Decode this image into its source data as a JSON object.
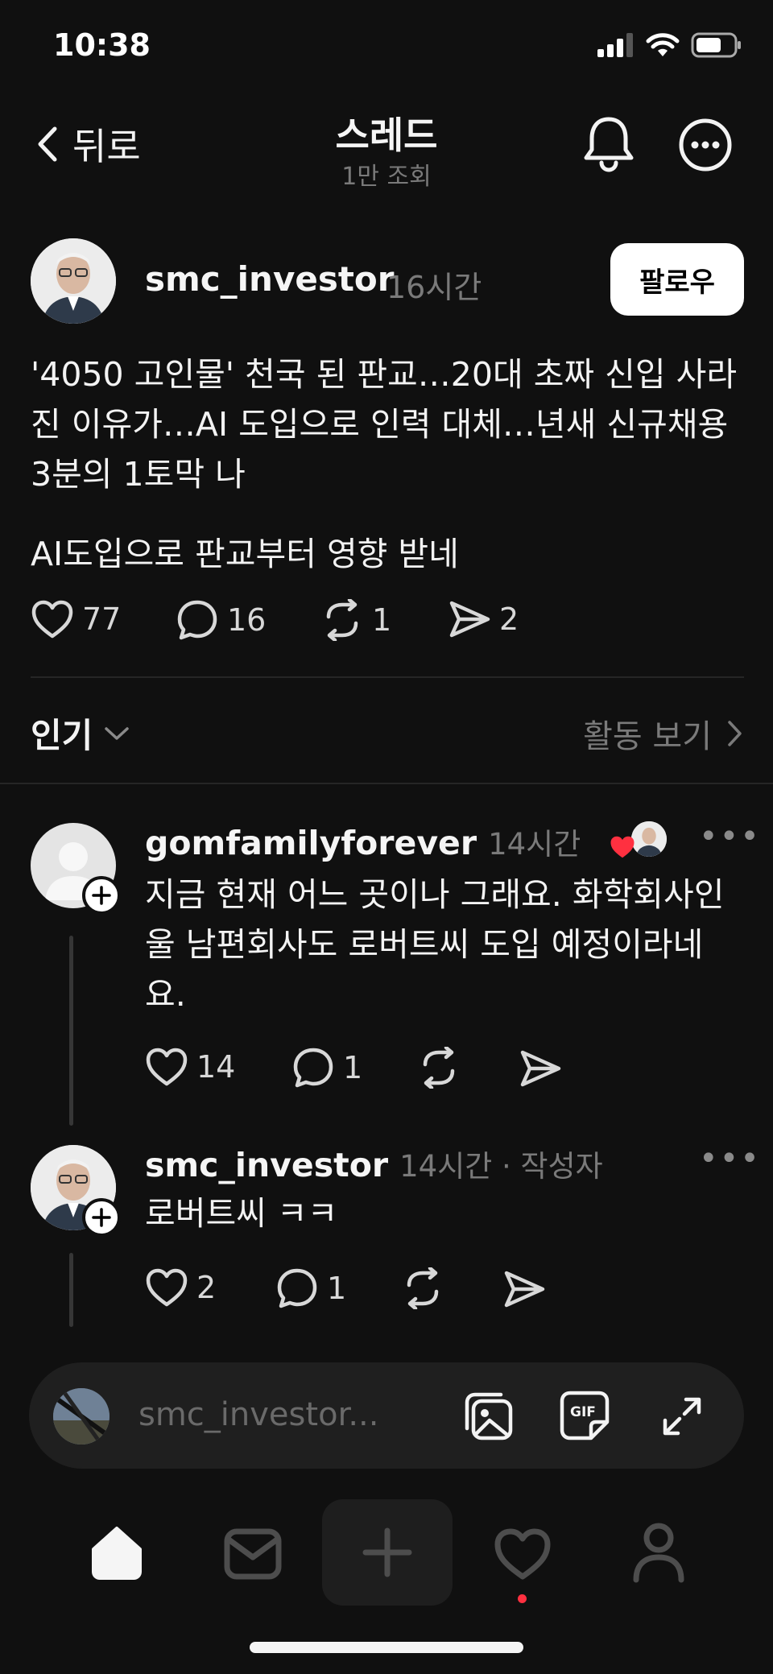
{
  "status_bar": {
    "time": "10:38"
  },
  "header": {
    "back_label": "뒤로",
    "title": "스레드",
    "views": "1만 조회"
  },
  "post": {
    "author": "smc_investor",
    "time": "16시간",
    "follow_label": "팔로우",
    "text": "'4050 고인물' 천국 된 판교…20대 초짜 신입 사라진 이유가…AI 도입으로 인력 대체…년새 신규채용 3분의 1토막 나",
    "text2": "AI도입으로 판교부터 영향 받네",
    "likes": "77",
    "comments": "16",
    "reposts": "1",
    "shares": "2"
  },
  "sort": {
    "label": "인기",
    "activity_label": "활동 보기"
  },
  "replies": [
    {
      "author": "gomfamilyforever",
      "time": "14시간",
      "text": "지금 현재 어느 곳이나 그래요. 화학회사인 울 남편회사도 로버트씨 도입 예정이라네요.",
      "likes": "14",
      "comments": "1"
    },
    {
      "author": "smc_investor",
      "time": "14시간 · 작성자",
      "text": "로버트씨 ㅋㅋ",
      "likes": "2",
      "comments": "1"
    }
  ],
  "composer": {
    "placeholder": "smc_investor..."
  },
  "colors": {
    "background": "#101010",
    "accent_red": "#ff3040",
    "follow_bg": "#ffffff"
  }
}
